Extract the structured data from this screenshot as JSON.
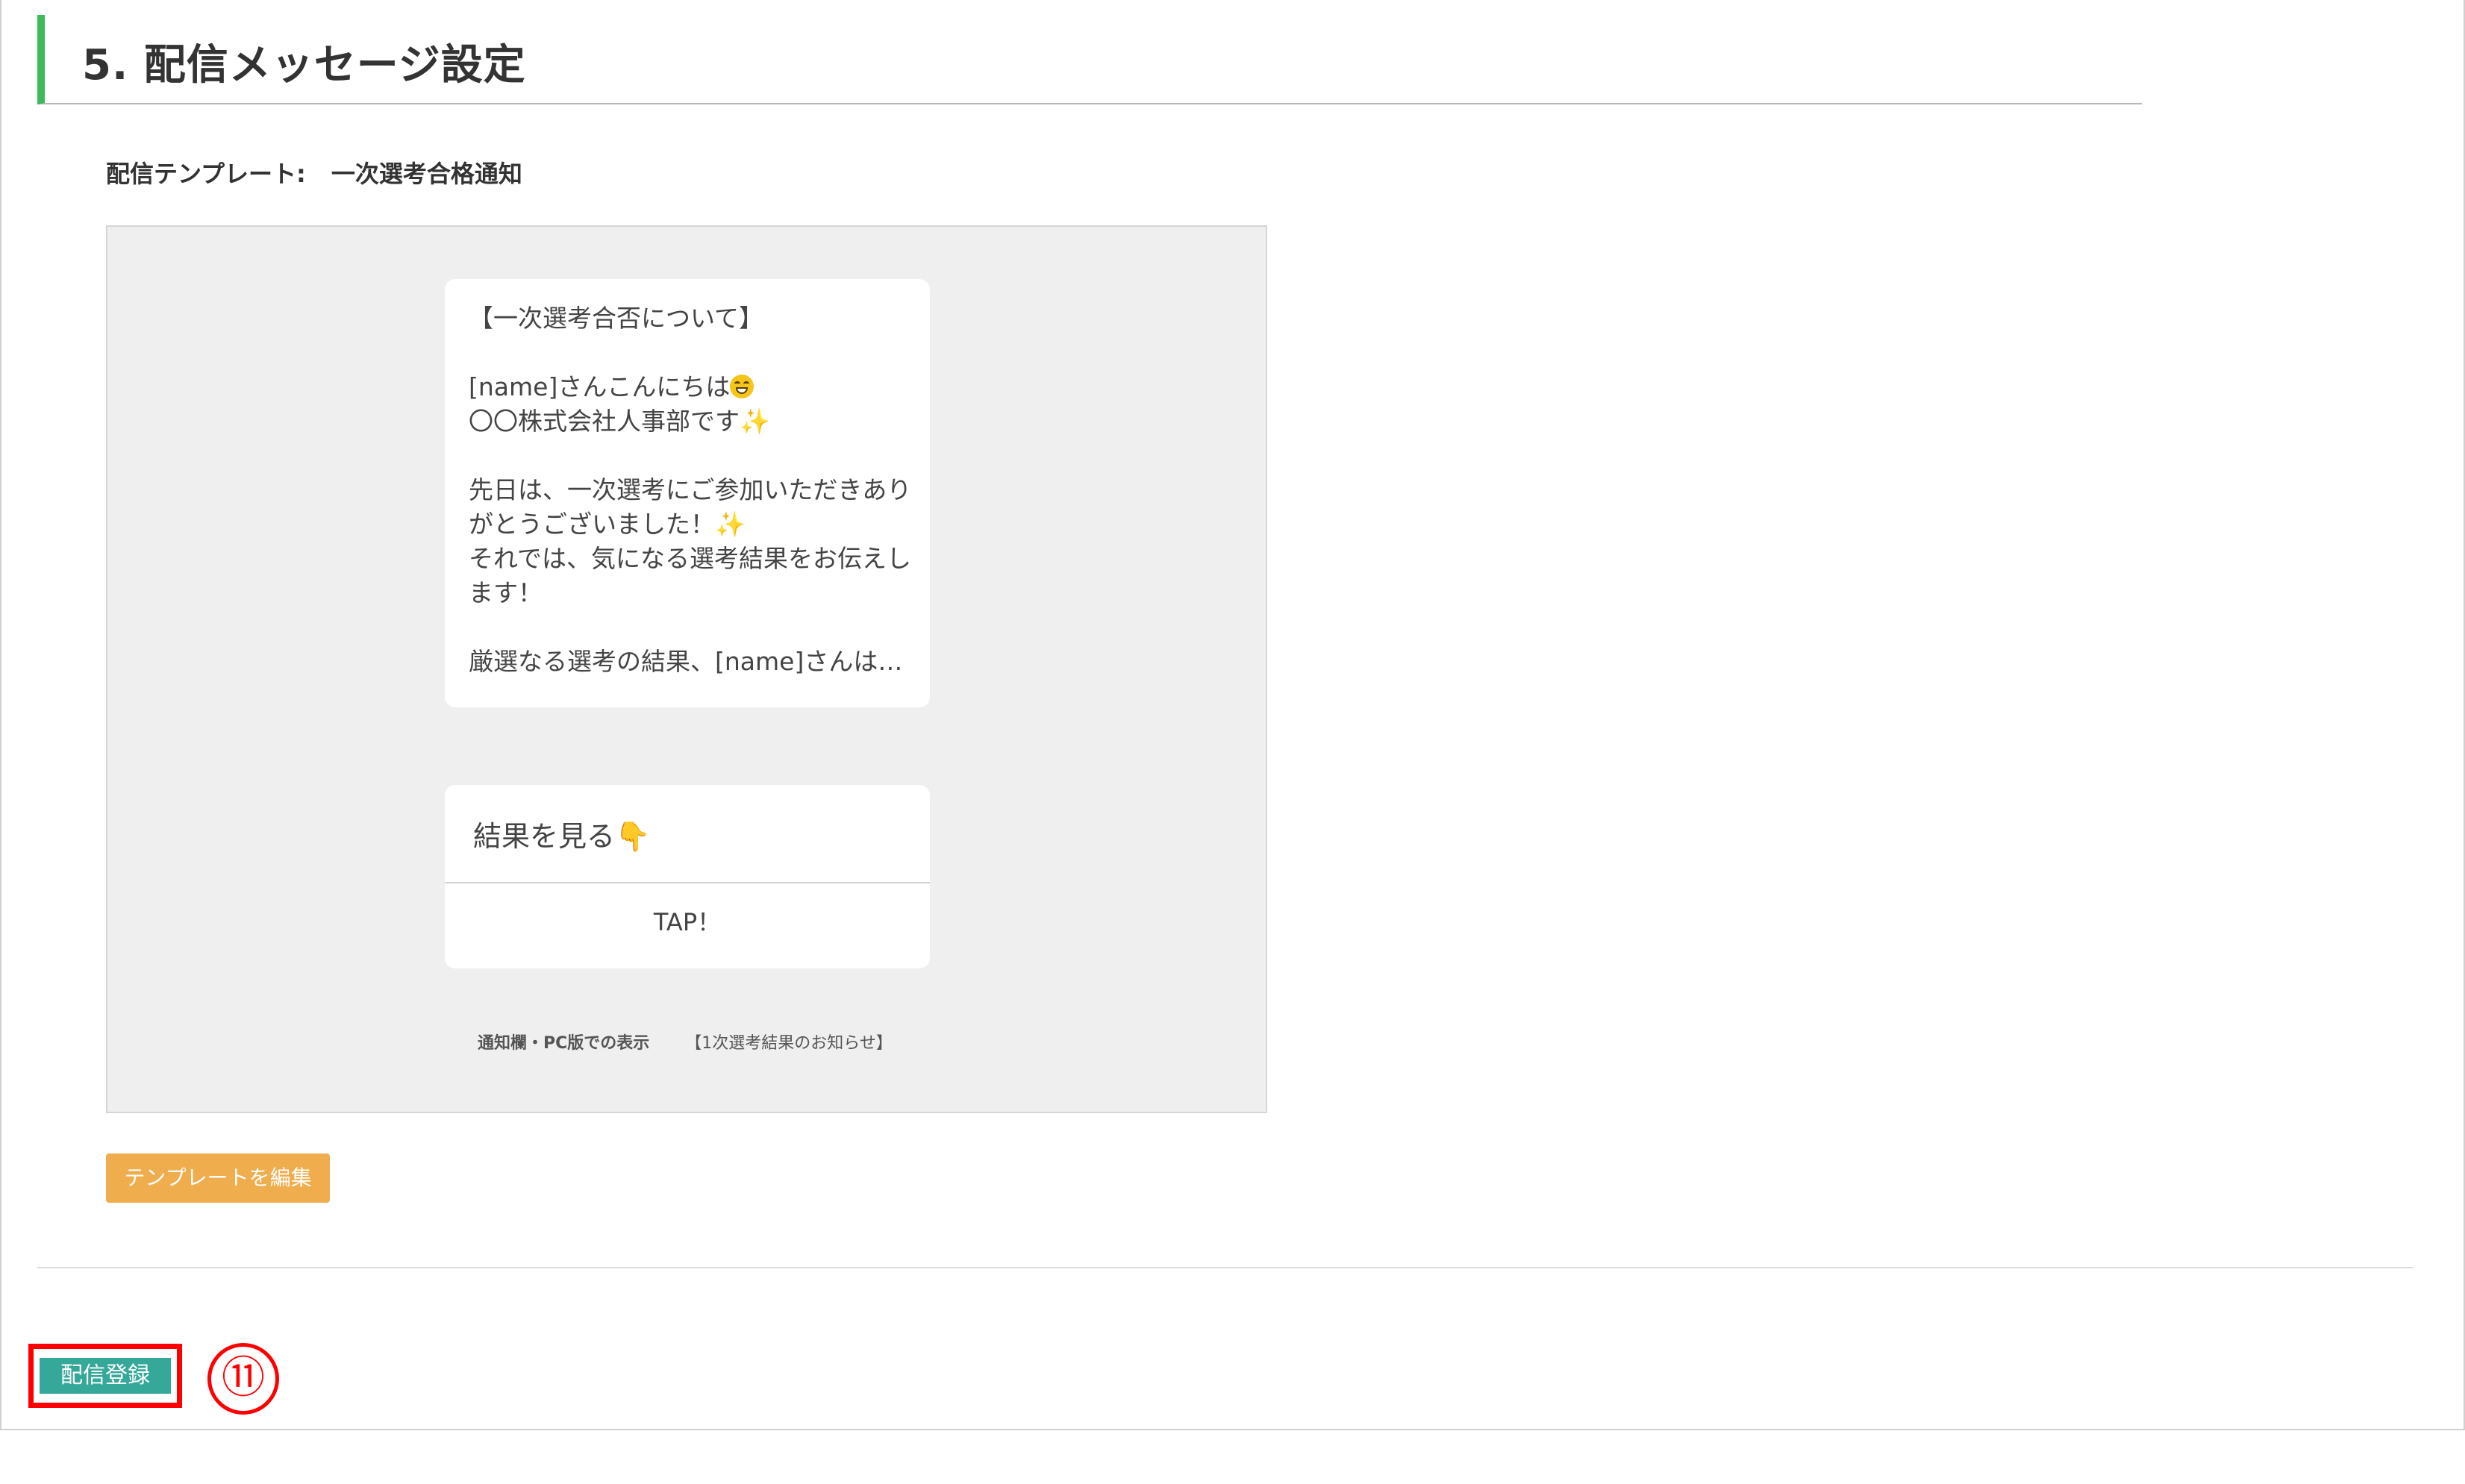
{
  "section": {
    "title": "5. 配信メッセージ設定"
  },
  "template": {
    "label": "配信テンプレート:",
    "name": "一次選考合格通知"
  },
  "message": {
    "lines": [
      "【一次選考合否について】",
      "",
      "[name]さんこんにちは",
      "〇〇株式会社人事部です",
      "",
      "先日は、一次選考にご参加いただきあり",
      "がとうございました！",
      "それでは、気になる選考結果をお伝えし",
      "ます！",
      "",
      "厳選なる選考の結果、[name]さんは…"
    ]
  },
  "card": {
    "title": "結果を見る",
    "action": "TAP！"
  },
  "notice": {
    "label": "通知欄・PC版での表示",
    "value": "【1次選考結果のお知らせ】"
  },
  "buttons": {
    "edit_template": "テンプレートを編集",
    "register": "配信登録"
  },
  "annotation": {
    "step": "⑪"
  },
  "icons": {
    "grin": "grinning-face-icon",
    "sparkles": "sparkles-icon",
    "point_down": "backhand-point-down-icon"
  },
  "colors": {
    "header_accent": "#3fba5a",
    "edit_button": "#f0ad4e",
    "register_button": "#35a89a",
    "highlight": "#ff0000"
  }
}
